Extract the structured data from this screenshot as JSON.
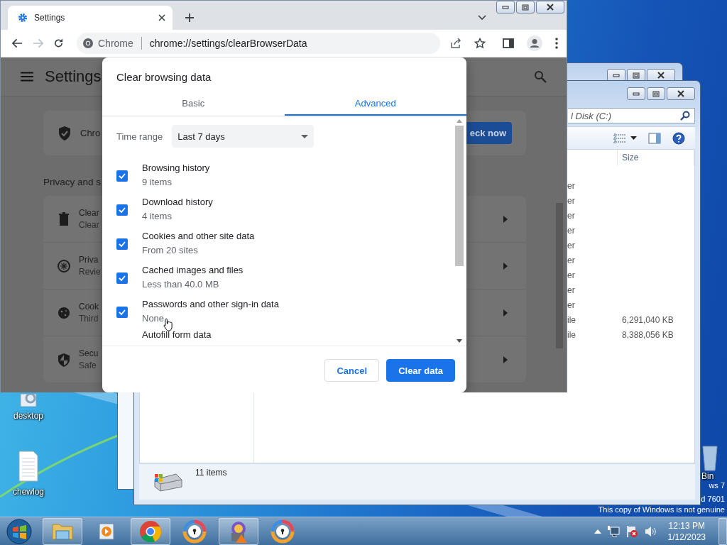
{
  "chrome": {
    "tab_title": "Settings",
    "omnibox_chip": "Chrome",
    "url": "chrome://settings/clearBrowserData",
    "settings": {
      "title": "Settings",
      "safety_check": {
        "text": "Chro",
        "button": "eck now"
      },
      "section_title": "Privacy and s",
      "rows": [
        {
          "kind": "trash",
          "title": "Clear",
          "subtitle": "Clear"
        },
        {
          "kind": "compass",
          "title": "Priva",
          "subtitle": "Revie"
        },
        {
          "kind": "cookie",
          "title": "Cook",
          "subtitle": "Third"
        },
        {
          "kind": "shield",
          "title": "Secu",
          "subtitle": "Safe"
        }
      ]
    }
  },
  "dialog": {
    "title": "Clear browsing data",
    "tabs": [
      {
        "label": "Basic",
        "selected": false
      },
      {
        "label": "Advanced",
        "selected": true
      }
    ],
    "time_range": {
      "label": "Time range",
      "value": "Last 7 days"
    },
    "items": [
      {
        "label": "Browsing history",
        "detail": "9 items",
        "checked": true
      },
      {
        "label": "Download history",
        "detail": "4 items",
        "checked": true
      },
      {
        "label": "Cookies and other site data",
        "detail": "From 20 sites",
        "checked": true
      },
      {
        "label": "Cached images and files",
        "detail": "Less than 40.0 MB",
        "checked": true
      },
      {
        "label": "Passwords and other sign-in data",
        "detail": "None",
        "checked": true
      }
    ],
    "cut_item": "Autofill form data",
    "buttons": [
      {
        "label": "Cancel",
        "kind": "secondary"
      },
      {
        "label": "Clear data",
        "kind": "primary"
      }
    ]
  },
  "explorer": {
    "address": "l Disk (C:)",
    "columns": [
      {
        "label": "Size"
      }
    ],
    "rows": [
      {
        "column_1": "er"
      },
      {
        "column_1": "er"
      },
      {
        "column_1": "er"
      },
      {
        "column_1": "er"
      },
      {
        "column_1": "er"
      },
      {
        "column_1": "er"
      },
      {
        "column_1": "er"
      },
      {
        "column_1": "er"
      },
      {
        "column_1": "er"
      },
      {
        "column_1": "ile",
        "size": "6,291,040 KB"
      },
      {
        "column_1": "ile",
        "size": "8,388,056 KB"
      }
    ],
    "status": "11 items"
  },
  "desktop": {
    "icons": [
      {
        "kind": "config",
        "label": "desktop"
      },
      {
        "kind": "textfile",
        "label": "chewlog"
      }
    ],
    "recycle_bin_label": "Bin",
    "os_notice": [
      "ws 7",
      "d 7601",
      "This copy of Windows is not genuine"
    ]
  },
  "taskbar": {
    "apps": [
      {
        "kind": "folder",
        "running": true
      },
      {
        "kind": "player",
        "running": false
      },
      {
        "kind": "browser",
        "running": true
      },
      {
        "kind": "lockbrowser",
        "running": false
      },
      {
        "kind": "installer",
        "running": true
      },
      {
        "kind": "lockbrowser",
        "running": false
      }
    ],
    "clock": {
      "time": "12:13 PM",
      "date": "1/12/2023"
    }
  }
}
